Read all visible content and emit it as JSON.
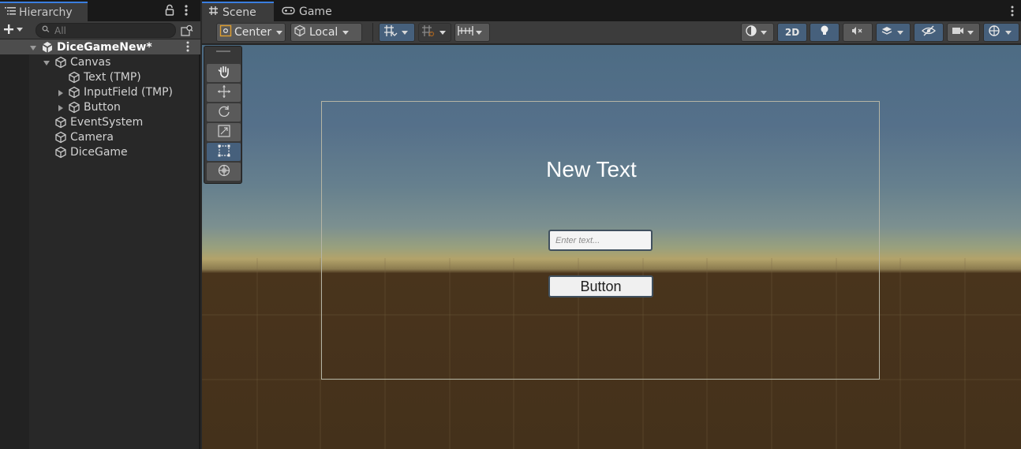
{
  "hierarchy": {
    "tab_label": "Hierarchy",
    "search_placeholder": "All",
    "items": [
      {
        "label": "DiceGameNew*"
      },
      {
        "label": "Canvas"
      },
      {
        "label": "Text (TMP)"
      },
      {
        "label": "InputField (TMP)"
      },
      {
        "label": "Button"
      },
      {
        "label": "EventSystem"
      },
      {
        "label": "Camera"
      },
      {
        "label": "DiceGame"
      }
    ]
  },
  "scene": {
    "tabs": [
      {
        "label": "Scene"
      },
      {
        "label": "Game"
      }
    ],
    "toolbar": {
      "pivot_mode": "Center",
      "pivot_space": "Local",
      "mode_2d": "2D"
    },
    "viewport": {
      "text_label": "New Text",
      "input_placeholder": "Enter text...",
      "button_label": "Button"
    }
  },
  "colors": {
    "accent": "#3a7ee0",
    "selected_tool": "#46607c",
    "ground": "#44311b",
    "sky": "#4d6c84"
  }
}
